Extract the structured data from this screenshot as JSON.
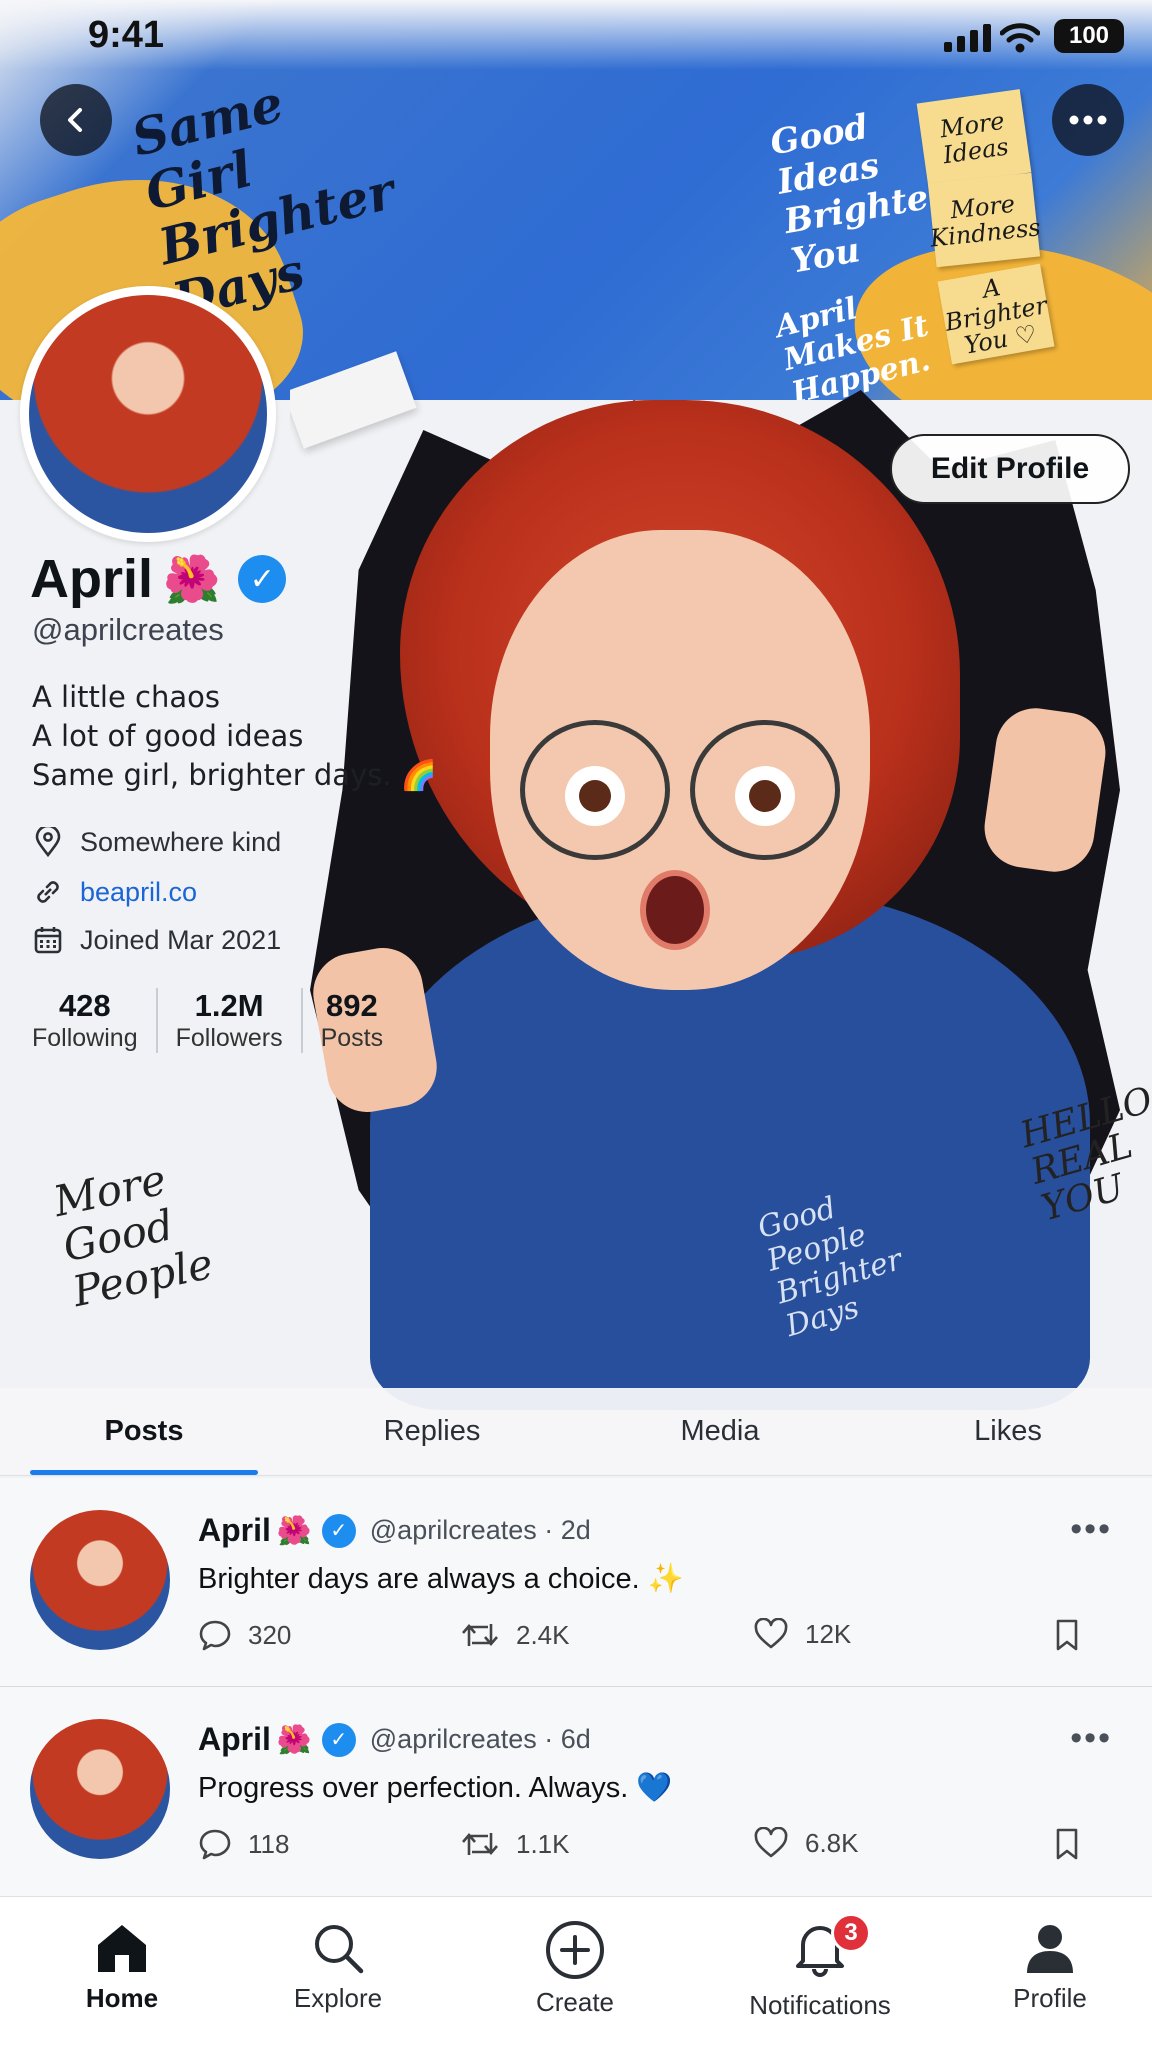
{
  "status_bar": {
    "time": "9:41",
    "battery": "100"
  },
  "banner": {
    "left_text": "Same Girl Brighter Days",
    "right_text": "Good Ideas Brighter You",
    "right_text_2": "April Makes It Happen.",
    "notes": [
      "More Ideas",
      "More Kindness",
      "A Brighter You ♡"
    ]
  },
  "hero": {
    "hoodie_text": "Good People Brighter Days",
    "left_hand_text": "More Good People",
    "right_hand_text": "HELLO REAL YOU"
  },
  "profile": {
    "edit_label": "Edit Profile",
    "name": "April",
    "flower": "🌺",
    "handle": "@aprilcreates",
    "bio": [
      "A little chaos",
      "A lot of good ideas",
      "Same girl, brighter days. 🌈"
    ],
    "location": "Somewhere kind",
    "website": "beapril.co",
    "joined": "Joined Mar 2021",
    "stats": [
      {
        "value": "428",
        "label": "Following"
      },
      {
        "value": "1.2M",
        "label": "Followers"
      },
      {
        "value": "892",
        "label": "Posts"
      }
    ]
  },
  "tabs": [
    "Posts",
    "Replies",
    "Media",
    "Likes"
  ],
  "posts": [
    {
      "name": "April",
      "flower": "🌺",
      "handle": "@aprilcreates · 2d",
      "text": "Brighter days are always a choice. ✨",
      "replies": "320",
      "reposts": "2.4K",
      "likes": "12K"
    },
    {
      "name": "April",
      "flower": "🌺",
      "handle": "@aprilcreates · 6d",
      "text": "Progress over perfection. Always. 💙",
      "replies": "118",
      "reposts": "1.1K",
      "likes": "6.8K"
    }
  ],
  "nav": {
    "items": [
      "Home",
      "Explore",
      "Create",
      "Notifications",
      "Profile"
    ],
    "notifications_badge": "3"
  },
  "colors": {
    "accent": "#1d7bf0",
    "verified": "#1d8ef0",
    "badge": "#e0303a",
    "link": "#1b66d6"
  }
}
